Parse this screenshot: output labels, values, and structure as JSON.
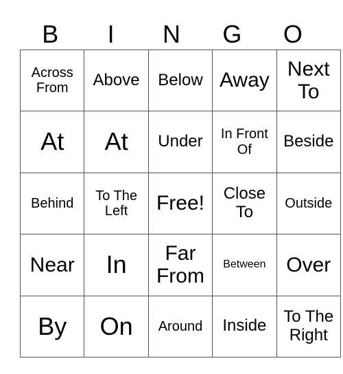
{
  "header": {
    "letters": [
      "B",
      "I",
      "N",
      "G",
      "O"
    ]
  },
  "card": {
    "rows": [
      [
        {
          "text": "Across From",
          "size": "s-s"
        },
        {
          "text": "Above",
          "size": "s-m"
        },
        {
          "text": "Below",
          "size": "s-m"
        },
        {
          "text": "Away",
          "size": "s-l"
        },
        {
          "text": "Next To",
          "size": "s-l"
        }
      ],
      [
        {
          "text": "At",
          "size": "s-xl"
        },
        {
          "text": "At",
          "size": "s-xl"
        },
        {
          "text": "Under",
          "size": "s-m"
        },
        {
          "text": "In Front Of",
          "size": "s-s"
        },
        {
          "text": "Beside",
          "size": "s-m"
        }
      ],
      [
        {
          "text": "Behind",
          "size": "s-s"
        },
        {
          "text": "To The Left",
          "size": "s-s"
        },
        {
          "text": "Free!",
          "size": "s-l"
        },
        {
          "text": "Close To",
          "size": "s-m"
        },
        {
          "text": "Outside",
          "size": "s-s"
        }
      ],
      [
        {
          "text": "Near",
          "size": "s-l"
        },
        {
          "text": "In",
          "size": "s-xl"
        },
        {
          "text": "Far From",
          "size": "s-l"
        },
        {
          "text": "Between",
          "size": "s-xs"
        },
        {
          "text": "Over",
          "size": "s-l"
        }
      ],
      [
        {
          "text": "By",
          "size": "s-xl"
        },
        {
          "text": "On",
          "size": "s-xl"
        },
        {
          "text": "Around",
          "size": "s-s"
        },
        {
          "text": "Inside",
          "size": "s-m"
        },
        {
          "text": "To The Right",
          "size": "s-m"
        }
      ]
    ]
  }
}
